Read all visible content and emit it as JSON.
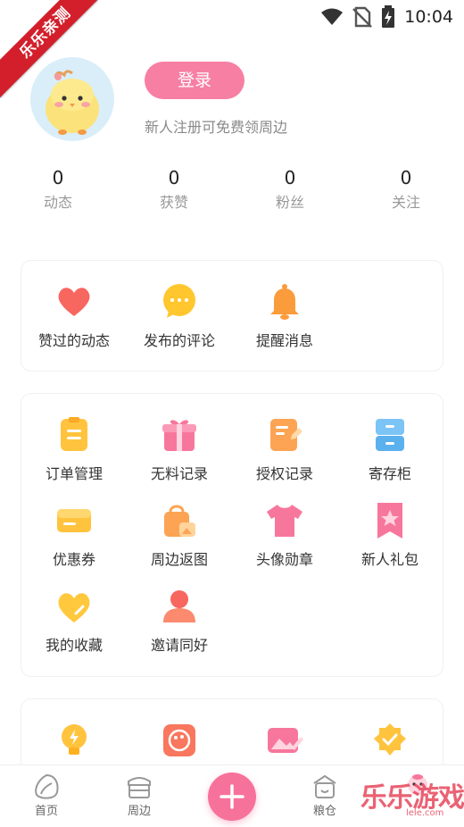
{
  "status_bar": {
    "time": "10:04",
    "icons": [
      "wifi-icon",
      "no-sim-icon",
      "battery-charging-icon"
    ]
  },
  "ribbon": {
    "text": "乐乐亲测"
  },
  "profile": {
    "login_label": "登录",
    "hint": "新人注册可免费领周边"
  },
  "stats": [
    {
      "value": "0",
      "label": "动态"
    },
    {
      "value": "0",
      "label": "获赞"
    },
    {
      "value": "0",
      "label": "粉丝"
    },
    {
      "value": "0",
      "label": "关注"
    }
  ],
  "card1": [
    {
      "label": "赞过的动态",
      "icon": "heart-icon"
    },
    {
      "label": "发布的评论",
      "icon": "comment-icon"
    },
    {
      "label": "提醒消息",
      "icon": "bell-icon"
    }
  ],
  "card2": [
    {
      "label": "订单管理",
      "icon": "order-icon"
    },
    {
      "label": "无料记录",
      "icon": "gift-box-icon"
    },
    {
      "label": "授权记录",
      "icon": "document-edit-icon"
    },
    {
      "label": "寄存柜",
      "icon": "cabinet-icon"
    },
    {
      "label": "优惠券",
      "icon": "coupon-icon"
    },
    {
      "label": "周边返图",
      "icon": "bag-photo-icon"
    },
    {
      "label": "头像勋章",
      "icon": "shirt-icon"
    },
    {
      "label": "新人礼包",
      "icon": "bookmark-star-icon"
    },
    {
      "label": "我的收藏",
      "icon": "heart-favorite-icon"
    },
    {
      "label": "邀请同好",
      "icon": "user-icon"
    }
  ],
  "card3": [
    {
      "icon": "lightbulb-icon"
    },
    {
      "icon": "palette-icon"
    },
    {
      "icon": "image-edit-icon"
    },
    {
      "icon": "verified-badge-icon"
    }
  ],
  "tabbar": [
    {
      "label": "首页",
      "icon": "home-icon"
    },
    {
      "label": "周边",
      "icon": "shop-icon"
    },
    {
      "label": "",
      "icon": "plus-icon"
    },
    {
      "label": "粮仓",
      "icon": "granary-icon"
    },
    {
      "label": "",
      "icon": "mine-icon"
    }
  ],
  "watermark": {
    "text": "乐乐游戏",
    "sub": "lele.com"
  }
}
